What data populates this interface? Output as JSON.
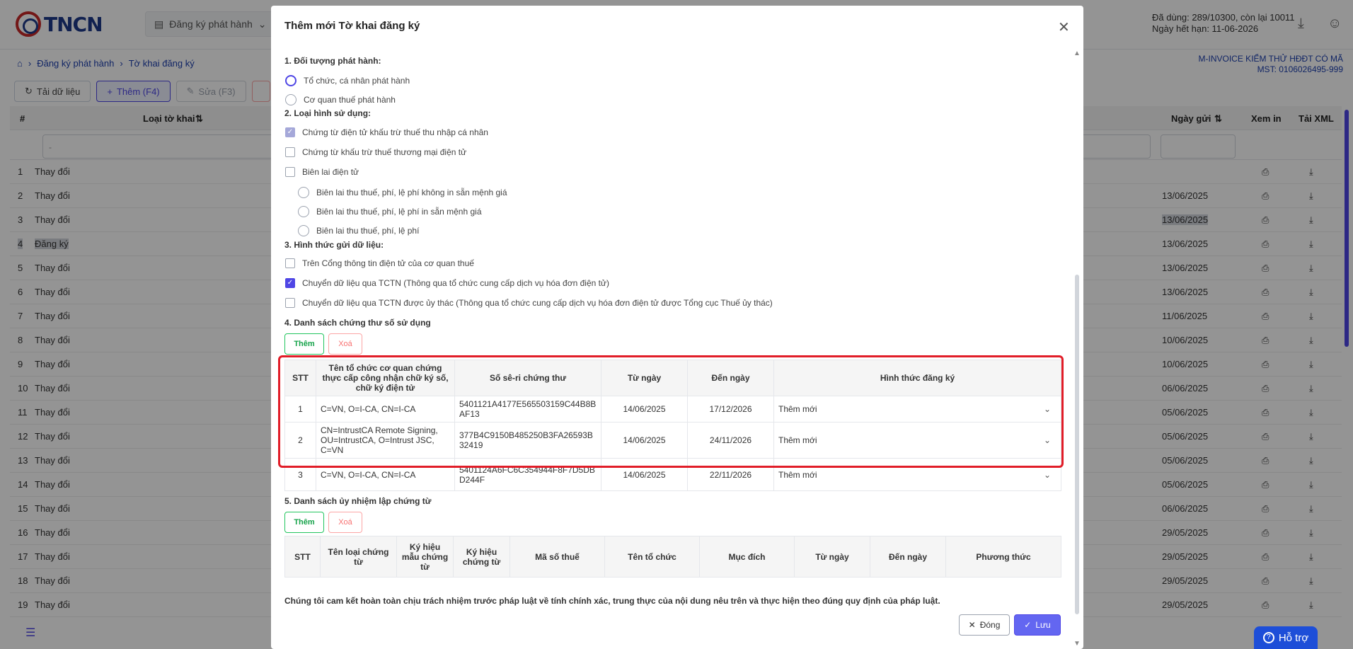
{
  "app": {
    "logo_text": "TNCN",
    "menu_label": "Đăng ký phát hành",
    "usage_text": "Đã dùng: 289/10300, còn lại 10011",
    "expiry_text": "Ngày hết hạn: 11-06-2026",
    "breadcrumb": [
      "Đăng ký phát hành",
      "Tờ khai đăng ký"
    ],
    "company_name": "M-INVOICE KIỂM THỬ HĐĐT CÓ MÃ",
    "company_tax": "MST: 0106026495-999",
    "toolbar": {
      "reload": "Tải dữ liệu",
      "add": "Thêm (F4)",
      "edit": "Sửa (F3)"
    },
    "grid": {
      "col_no": "#",
      "col_type": "Loại tờ khai",
      "col_date": "Ngày gửi",
      "col_view": "Xem in",
      "col_xml": "Tải XML",
      "filter_type": "-",
      "rows": [
        {
          "no": "1",
          "type": "Thay đổi",
          "date": ""
        },
        {
          "no": "2",
          "type": "Thay đổi",
          "date": "13/06/2025"
        },
        {
          "no": "3",
          "type": "Thay đổi",
          "date": "13/06/2025"
        },
        {
          "no": "4",
          "type": "Đăng ký",
          "date": "13/06/2025"
        },
        {
          "no": "5",
          "type": "Thay đổi",
          "date": "13/06/2025"
        },
        {
          "no": "6",
          "type": "Thay đổi",
          "date": "13/06/2025"
        },
        {
          "no": "7",
          "type": "Thay đổi",
          "date": "11/06/2025"
        },
        {
          "no": "8",
          "type": "Thay đổi",
          "date": "10/06/2025"
        },
        {
          "no": "9",
          "type": "Thay đổi",
          "date": "10/06/2025"
        },
        {
          "no": "10",
          "type": "Thay đổi",
          "date": "06/06/2025"
        },
        {
          "no": "11",
          "type": "Thay đổi",
          "date": "05/06/2025"
        },
        {
          "no": "12",
          "type": "Thay đổi",
          "date": "05/06/2025"
        },
        {
          "no": "13",
          "type": "Thay đổi",
          "date": "05/06/2025"
        },
        {
          "no": "14",
          "type": "Thay đổi",
          "date": "05/06/2025"
        },
        {
          "no": "15",
          "type": "Thay đổi",
          "date": "06/06/2025"
        },
        {
          "no": "16",
          "type": "Thay đổi",
          "date": "29/05/2025"
        },
        {
          "no": "17",
          "type": "Thay đổi",
          "date": "29/05/2025"
        },
        {
          "no": "18",
          "type": "Thay đổi",
          "date": "29/05/2025"
        },
        {
          "no": "19",
          "type": "Thay đổi",
          "date": "29/05/2025"
        }
      ]
    },
    "support_label": "Hỗ trợ"
  },
  "modal": {
    "title": "Thêm mới Tờ khai đăng ký",
    "section1": {
      "title": "1. Đối tượng phát hành:",
      "options": [
        "Tổ chức, cá nhân phát hành",
        "Cơ quan thuế phát hành"
      ]
    },
    "section2": {
      "title": "2. Loại hình sử dụng:",
      "options": [
        "Chứng từ điện tử khấu trừ thuế thu nhập cá nhân",
        "Chứng từ khấu trừ thuế thương mại điện tử",
        "Biên lai điện tử"
      ],
      "sub_options": [
        "Biên lai thu thuế, phí, lệ phí không in sẵn mệnh giá",
        "Biên lai thu thuế, phí, lệ phí in sẵn mệnh giá",
        "Biên lai thu thuế, phí, lệ phí"
      ]
    },
    "section3": {
      "title": "3. Hình thức gửi dữ liệu:",
      "options": [
        "Trên Cổng thông tin điện tử của cơ quan thuế",
        "Chuyển dữ liệu qua TCTN (Thông qua tổ chức cung cấp dịch vụ hóa đơn điện tử)",
        "Chuyển dữ liệu qua TCTN được ủy thác (Thông qua tổ chức cung cấp dịch vụ hóa đơn điện tử được Tổng cục Thuế ủy thác)"
      ]
    },
    "section4": {
      "title": "4. Danh sách chứng thư số sử dụng",
      "add_label": "Thêm",
      "delete_label": "Xoá",
      "headers": [
        "STT",
        "Tên tổ chức cơ quan chứng thực cấp công nhận chữ ký số, chữ ký điện tử",
        "Số sê-ri chứng thư",
        "Từ ngày",
        "Đến ngày",
        "Hình thức đăng ký"
      ],
      "rows": [
        {
          "stt": "1",
          "org": "C=VN, O=I-CA, CN=I-CA",
          "serial": "5401121A4177E565503159C44B8BAF13",
          "from": "14/06/2025",
          "to": "17/12/2026",
          "form": "Thêm mới"
        },
        {
          "stt": "2",
          "org": "CN=IntrustCA Remote Signing, OU=IntrustCA, O=Intrust JSC, C=VN",
          "serial": "377B4C9150B485250B3FA26593B32419",
          "from": "14/06/2025",
          "to": "24/11/2026",
          "form": "Thêm mới"
        },
        {
          "stt": "3",
          "org": "C=VN, O=I-CA, CN=I-CA",
          "serial": "5401124A6FC6C354944F8F7D5DBD244F",
          "from": "14/06/2025",
          "to": "22/11/2026",
          "form": "Thêm mới"
        }
      ]
    },
    "section5": {
      "title": "5. Danh sách ủy nhiệm lập chứng từ",
      "add_label": "Thêm",
      "delete_label": "Xoá",
      "headers": [
        "STT",
        "Tên loại chứng từ",
        "Ký hiệu mẫu chứng từ",
        "Ký hiệu chứng từ",
        "Mã số thuế",
        "Tên tổ chức",
        "Mục đích",
        "Từ ngày",
        "Đến ngày",
        "Phương thức"
      ]
    },
    "commitment": "Chúng tôi cam kết hoàn toàn chịu trách nhiệm trước pháp luật về tính chính xác, trung thực của nội dung nêu trên và thực hiện theo đúng quy định của pháp luật.",
    "close_label": "Đóng",
    "save_label": "Lưu"
  },
  "colors": {
    "accent": "#4f46e5",
    "highlight_frame": "#e11d28",
    "add_green": "#22c55e",
    "delete_red": "#f87171"
  }
}
